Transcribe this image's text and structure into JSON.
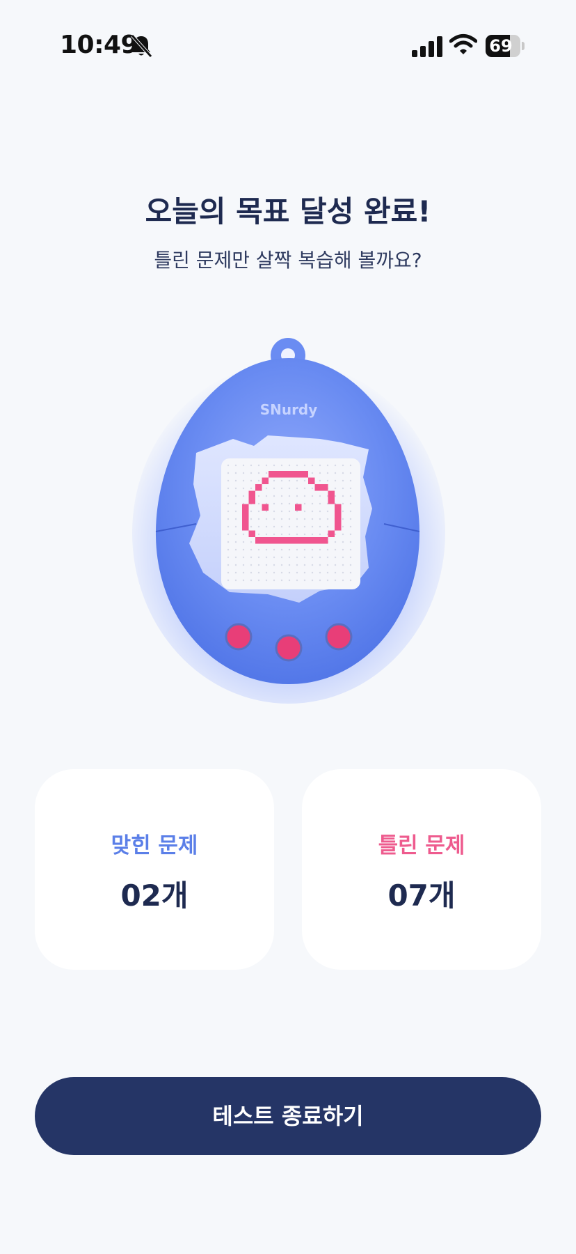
{
  "status_bar": {
    "time": "10:49",
    "battery": "69",
    "battery_level": 0.69,
    "icons": [
      "bell-slash-icon",
      "cellular-signal-icon",
      "wifi-icon",
      "battery-icon"
    ]
  },
  "header": {
    "title": "오늘의 목표 달성 완료!",
    "subtitle": "틀린 문제만 살짝 복습해 볼까요?"
  },
  "device": {
    "brand": "SNurdy",
    "colors": {
      "shell": "#5f83f0",
      "pixel": "#f0558f",
      "buttons": "#e83e78"
    }
  },
  "stats": {
    "correct": {
      "label": "맞힌 문제",
      "value": "02개"
    },
    "wrong": {
      "label": "틀린 문제",
      "value": "07개"
    }
  },
  "actions": {
    "end_test": "테스트 종료하기"
  },
  "colors": {
    "background": "#f6f8fb",
    "primary_dark": "#253566",
    "accent_blue": "#5b7fe8",
    "accent_pink": "#ee5b8e"
  }
}
